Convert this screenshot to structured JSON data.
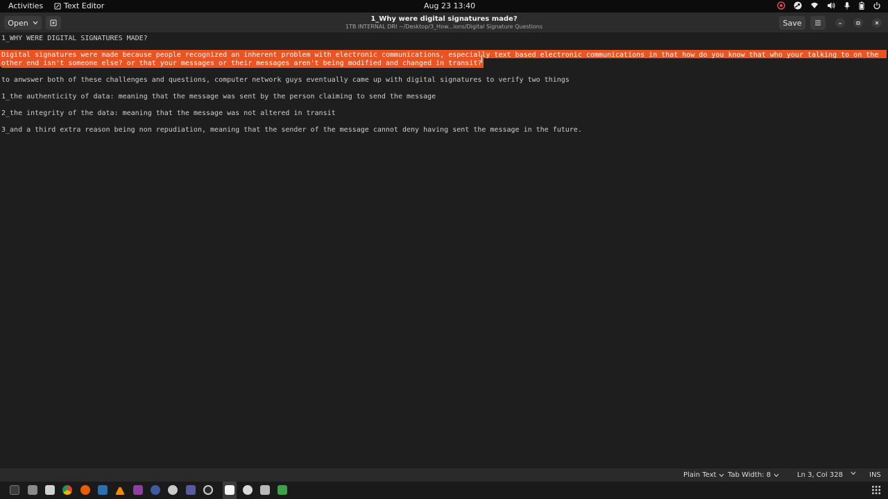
{
  "topbar": {
    "activities": "Activities",
    "app_name": "Text Editor",
    "datetime": "Aug 23  13:40"
  },
  "header": {
    "open_label": "Open",
    "save_label": "Save",
    "title": "1_Why were digital signatures made?",
    "subtitle": "1TB INTERNAL DRI ~/Desktop/3_How...ions/Digital Signature Questions"
  },
  "document": {
    "line1": "1_WHY WERE DIGITAL SIGNATURES MADE?",
    "line3a": "Digital signatures were made because people recognized an inherent problem with electronic communications, especially text based electronic communications in that how do you know that who your talking to on the",
    "line3b": "other end isn't someone else? or that your messages or their messages aren't being modified and changed in transit?",
    "line5": "to anwswer both of these challenges and questions, computer network guys eventually came up with digital signatures to verify two things",
    "line7": "1_the authenticity of data: meaning that the message was sent by the person claiming to send the message",
    "line9": "2_the integrity of the data: meaning that the message was not altered in transit",
    "line11": "3_and a third extra reason being non repudiation, meaning that the sender of the message cannot deny having sent the message in the future."
  },
  "statusbar": {
    "language": "Plain Text",
    "tab_width": "Tab Width: 8",
    "position": "Ln 3, Col 328",
    "mode": "INS"
  },
  "colors": {
    "selection": "#e95420",
    "background": "#1e1e1e",
    "header": "#2c2c2c"
  },
  "dock": {
    "icons": [
      "terminal-icon",
      "files-icon",
      "text-icon",
      "chrome-icon",
      "firefox-icon",
      "steam-icon",
      "vlc-icon",
      "app-icon",
      "settings-icon",
      "tool-icon",
      "network-icon",
      "obs-icon",
      "text-editor-icon",
      "disc-icon",
      "document-icon",
      "spreadsheet-icon",
      "apps-grid-icon"
    ]
  }
}
